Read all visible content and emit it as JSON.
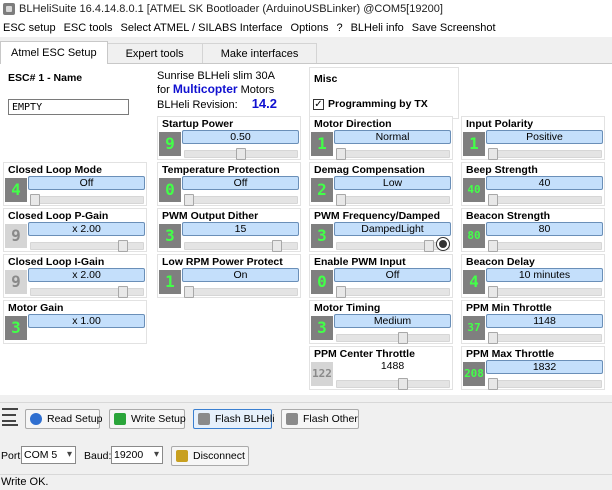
{
  "window": {
    "title": "BLHeliSuite 16.4.14.8.0.1  [ATMEL SK Bootloader (ArduinoUSBLinker) @COM5[19200]"
  },
  "menu": [
    "ESC setup",
    "ESC tools",
    "Select ATMEL / SILABS Interface",
    "Options",
    "?",
    "BLHeli info",
    "Save Screenshot"
  ],
  "tabs": [
    "Atmel ESC Setup",
    "Expert tools",
    "Make interfaces"
  ],
  "esc": {
    "label": "ESC# 1 - Name",
    "name": "EMPTY"
  },
  "info": {
    "line1": "Sunrise BLHeli slim 30A",
    "for": "for",
    "type": "Multicopter",
    "motors": "Motors",
    "rev_label": "BLHeli Revision:",
    "revision": "14.2"
  },
  "misc": {
    "label": "Misc",
    "check_label": "Programming by TX",
    "checked": true
  },
  "params": {
    "startup_power": {
      "label": "Startup Power",
      "value": "0.50",
      "num": "9",
      "level": 0.5
    },
    "motor_direction": {
      "label": "Motor Direction",
      "value": "Normal",
      "num": "1",
      "level": 0.0
    },
    "input_polarity": {
      "label": "Input Polarity",
      "value": "Positive",
      "num": "1",
      "level": 0.0
    },
    "closed_loop_mode": {
      "label": "Closed Loop Mode",
      "value": "Off",
      "num": "4",
      "level": 0.0
    },
    "temperature_protection": {
      "label": "Temperature Protection",
      "value": "Off",
      "num": "0",
      "level": 0.0
    },
    "demag_compensation": {
      "label": "Demag Compensation",
      "value": "Low",
      "num": "2",
      "level": 0.0
    },
    "beep_strength": {
      "label": "Beep Strength",
      "value": "40",
      "num": "40",
      "level": 0.0
    },
    "closed_loop_p_gain": {
      "label": "Closed Loop P-Gain",
      "value": "x 2.00",
      "num": "9",
      "level": 0.85
    },
    "pwm_output_dither": {
      "label": "PWM Output Dither",
      "value": "15",
      "num": "3",
      "level": 0.85
    },
    "pwm_frequency_damped": {
      "label": "PWM Frequency/Damped",
      "value": "DampedLight",
      "num": "3",
      "level": 0.85
    },
    "beacon_strength": {
      "label": "Beacon Strength",
      "value": "80",
      "num": "80",
      "level": 0.0
    },
    "closed_loop_i_gain": {
      "label": "Closed Loop I-Gain",
      "value": "x 2.00",
      "num": "9",
      "level": 0.85
    },
    "low_rpm_power_protect": {
      "label": "Low RPM Power Protect",
      "value": "On",
      "num": "1",
      "level": 0.0
    },
    "enable_pwm_input": {
      "label": "Enable PWM Input",
      "value": "Off",
      "num": "0",
      "level": 0.0
    },
    "beacon_delay": {
      "label": "Beacon Delay",
      "value": "10 minutes",
      "num": "4",
      "level": 0.0
    },
    "motor_gain": {
      "label": "Motor Gain",
      "value": "x 1.00",
      "num": "3",
      "level": 0.0
    },
    "motor_timing": {
      "label": "Motor Timing",
      "value": "Medium",
      "num": "3",
      "level": 0.6
    },
    "ppm_min_throttle": {
      "label": "PPM Min Throttle",
      "value": "1148",
      "num": "37",
      "level": 0.0
    },
    "ppm_center_throttle": {
      "label": "PPM Center Throttle",
      "value": "1488",
      "num": "122",
      "level": 0.6
    },
    "ppm_max_throttle": {
      "label": "PPM Max Throttle",
      "value": "1832",
      "num": "208",
      "level": 0.0
    }
  },
  "buttons": {
    "read_setup": "Read Setup",
    "write_setup": "Write Setup",
    "flash_blheli": "Flash BLHeli",
    "flash_other": "Flash Other",
    "disconnect": "Disconnect"
  },
  "port": {
    "port_label": "Port:",
    "port_value": "COM 5",
    "baud_label": "Baud:",
    "baud_value": "19200"
  },
  "status": "Write OK.",
  "colors": {
    "value_bg": "#c4dffb",
    "num_bg": "#7f7f7f",
    "num_fg": "#43ff49",
    "brand": "#1010d0"
  }
}
